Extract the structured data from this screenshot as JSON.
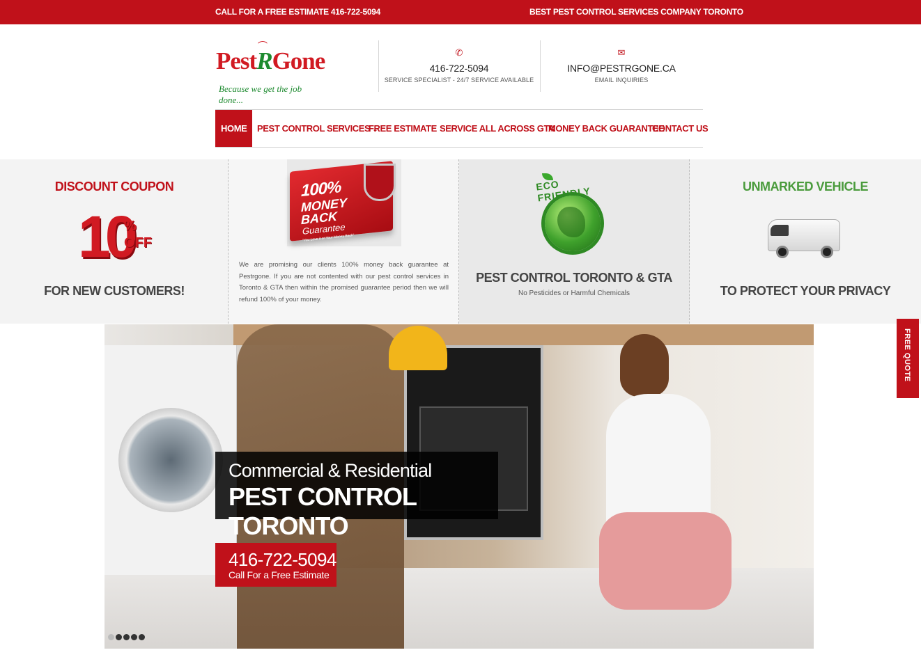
{
  "topbar": {
    "left_text": "CALL FOR A FREE ESTIMATE 416-722-5094",
    "right_text": "BEST PEST CONTROL SERVICES COMPANY TORONTO"
  },
  "logo": {
    "part1": "Pest",
    "part2": "R",
    "part3": "Gone",
    "tagline": "Because we get the job done..."
  },
  "contacts": [
    {
      "icon": "phone-icon",
      "main": "416-722-5094",
      "sub": "SERVICE SPECIALIST - 24/7 SERVICE AVAILABLE"
    },
    {
      "icon": "envelope-icon",
      "main": "INFO@PESTRGONE.CA",
      "sub": "EMAIL INQUIRIES"
    }
  ],
  "nav": {
    "items": [
      {
        "label": "HOME",
        "active": true
      },
      {
        "label": "PEST CONTROL SERVICES",
        "has_dropdown": true
      },
      {
        "label": "FREE ESTIMATE"
      },
      {
        "label": "SERVICE ALL ACROSS GTA"
      },
      {
        "label": "MONEY BACK GUARANTEE"
      },
      {
        "label": "CONTACT US"
      }
    ]
  },
  "features": {
    "coupon": {
      "title": "DISCOUNT COUPON",
      "big_number": "10",
      "percent": "%",
      "off": "OFF",
      "subtitle": "FOR NEW CUSTOMERS!"
    },
    "guarantee": {
      "badge_line1": "100%",
      "badge_line2": "MONEY",
      "badge_line3": "BACK",
      "badge_line4": "Guarantee",
      "badge_small": "\"You Love it or Your Money Back\"",
      "text": "We are promising our clients 100% money back guarantee at Pestrgone. If you are not contented with our pest control services in Toronto & GTA then within the promised guarantee period then we will refund 100% of your money."
    },
    "eco": {
      "badge_text": "ECO FRIENDLY",
      "title": "PEST CONTROL TORONTO & GTA",
      "subtitle": "No Pesticides or Harmful Chemicals"
    },
    "vehicle": {
      "title": "UNMARKED VEHICLE",
      "subtitle": "TO PROTECT YOUR PRIVACY"
    }
  },
  "hero": {
    "line1": "Commercial & Residential",
    "line2": "PEST CONTROL TORONTO",
    "phone": "416-722-5094",
    "phone_sub": "Call For a Free Estimate",
    "slides": 5,
    "active_slide": 1
  },
  "side_tab": {
    "label": "FREE QUOTE"
  },
  "colors": {
    "brand_red": "#c0111a",
    "brand_green": "#4a9b3c"
  }
}
